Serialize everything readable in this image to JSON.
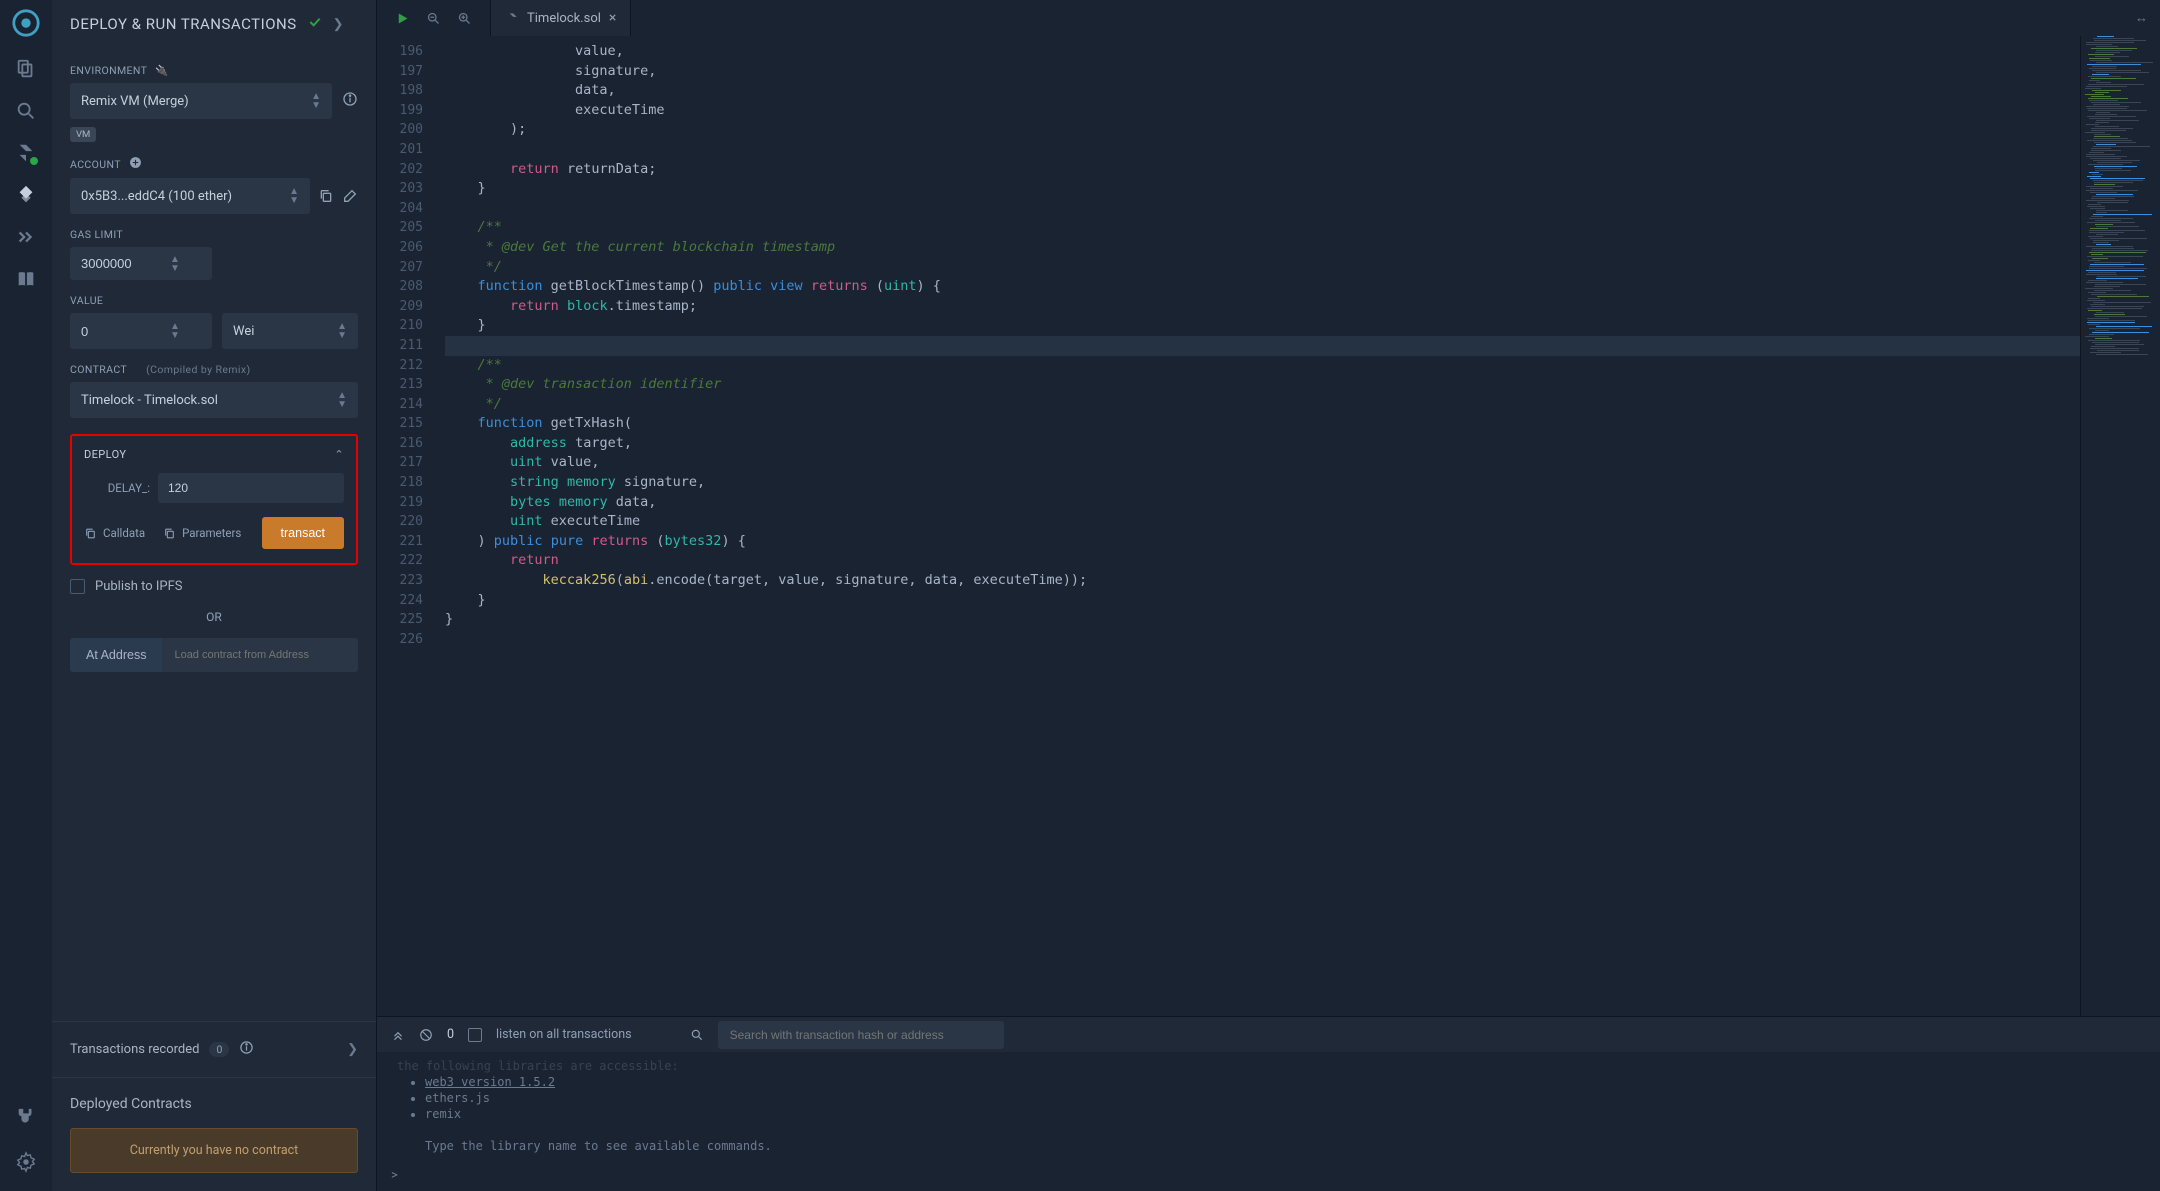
{
  "panel": {
    "title": "DEPLOY & RUN TRANSACTIONS",
    "environment_label": "ENVIRONMENT",
    "environment_value": "Remix VM (Merge)",
    "vm_tag": "VM",
    "account_label": "ACCOUNT",
    "account_value": "0x5B3...eddC4 (100 ether)",
    "gas_label": "GAS LIMIT",
    "gas_value": "3000000",
    "value_label": "VALUE",
    "value_amount": "0",
    "value_unit": "Wei",
    "contract_label": "CONTRACT",
    "contract_note": "(Compiled by Remix)",
    "contract_value": "Timelock - Timelock.sol",
    "deploy_label": "DEPLOY",
    "delay_label": "DELAY_:",
    "delay_value": "120",
    "calldata_label": "Calldata",
    "parameters_label": "Parameters",
    "transact_label": "transact",
    "ipfs_label": "Publish to IPFS",
    "or_label": "OR",
    "ataddress_label": "At Address",
    "ataddress_placeholder": "Load contract from Address",
    "tx_recorded_label": "Transactions recorded",
    "tx_recorded_count": "0",
    "deployed_label": "Deployed Contracts",
    "no_contract_msg": "Currently you have no contract"
  },
  "tabs": {
    "file": "Timelock.sol"
  },
  "editor": {
    "first_line": 196,
    "lines": [
      "                value,",
      "                signature,",
      "                data,",
      "                executeTime",
      "        );",
      "",
      "        return returnData;",
      "    }",
      "",
      "    /**",
      "     * @dev Get the current blockchain timestamp",
      "     */",
      "    function getBlockTimestamp() public view returns (uint) {",
      "        return block.timestamp;",
      "    }",
      "",
      "    /**",
      "     * @dev transaction identifier",
      "     */",
      "    function getTxHash(",
      "        address target,",
      "        uint value,",
      "        string memory signature,",
      "        bytes memory data,",
      "        uint executeTime",
      "    ) public pure returns (bytes32) {",
      "        return",
      "            keccak256(abi.encode(target, value, signature, data, executeTime));",
      "    }",
      "}",
      ""
    ]
  },
  "terminal": {
    "pending_count": "0",
    "listen_label": "listen on all transactions",
    "search_placeholder": "Search with transaction hash or address",
    "header_line": "  the following libraries are accessible:",
    "libs": [
      "web3 version 1.5.2",
      "ethers.js",
      "remix"
    ],
    "hint": "Type the library name to see available commands.",
    "prompt": ">"
  }
}
